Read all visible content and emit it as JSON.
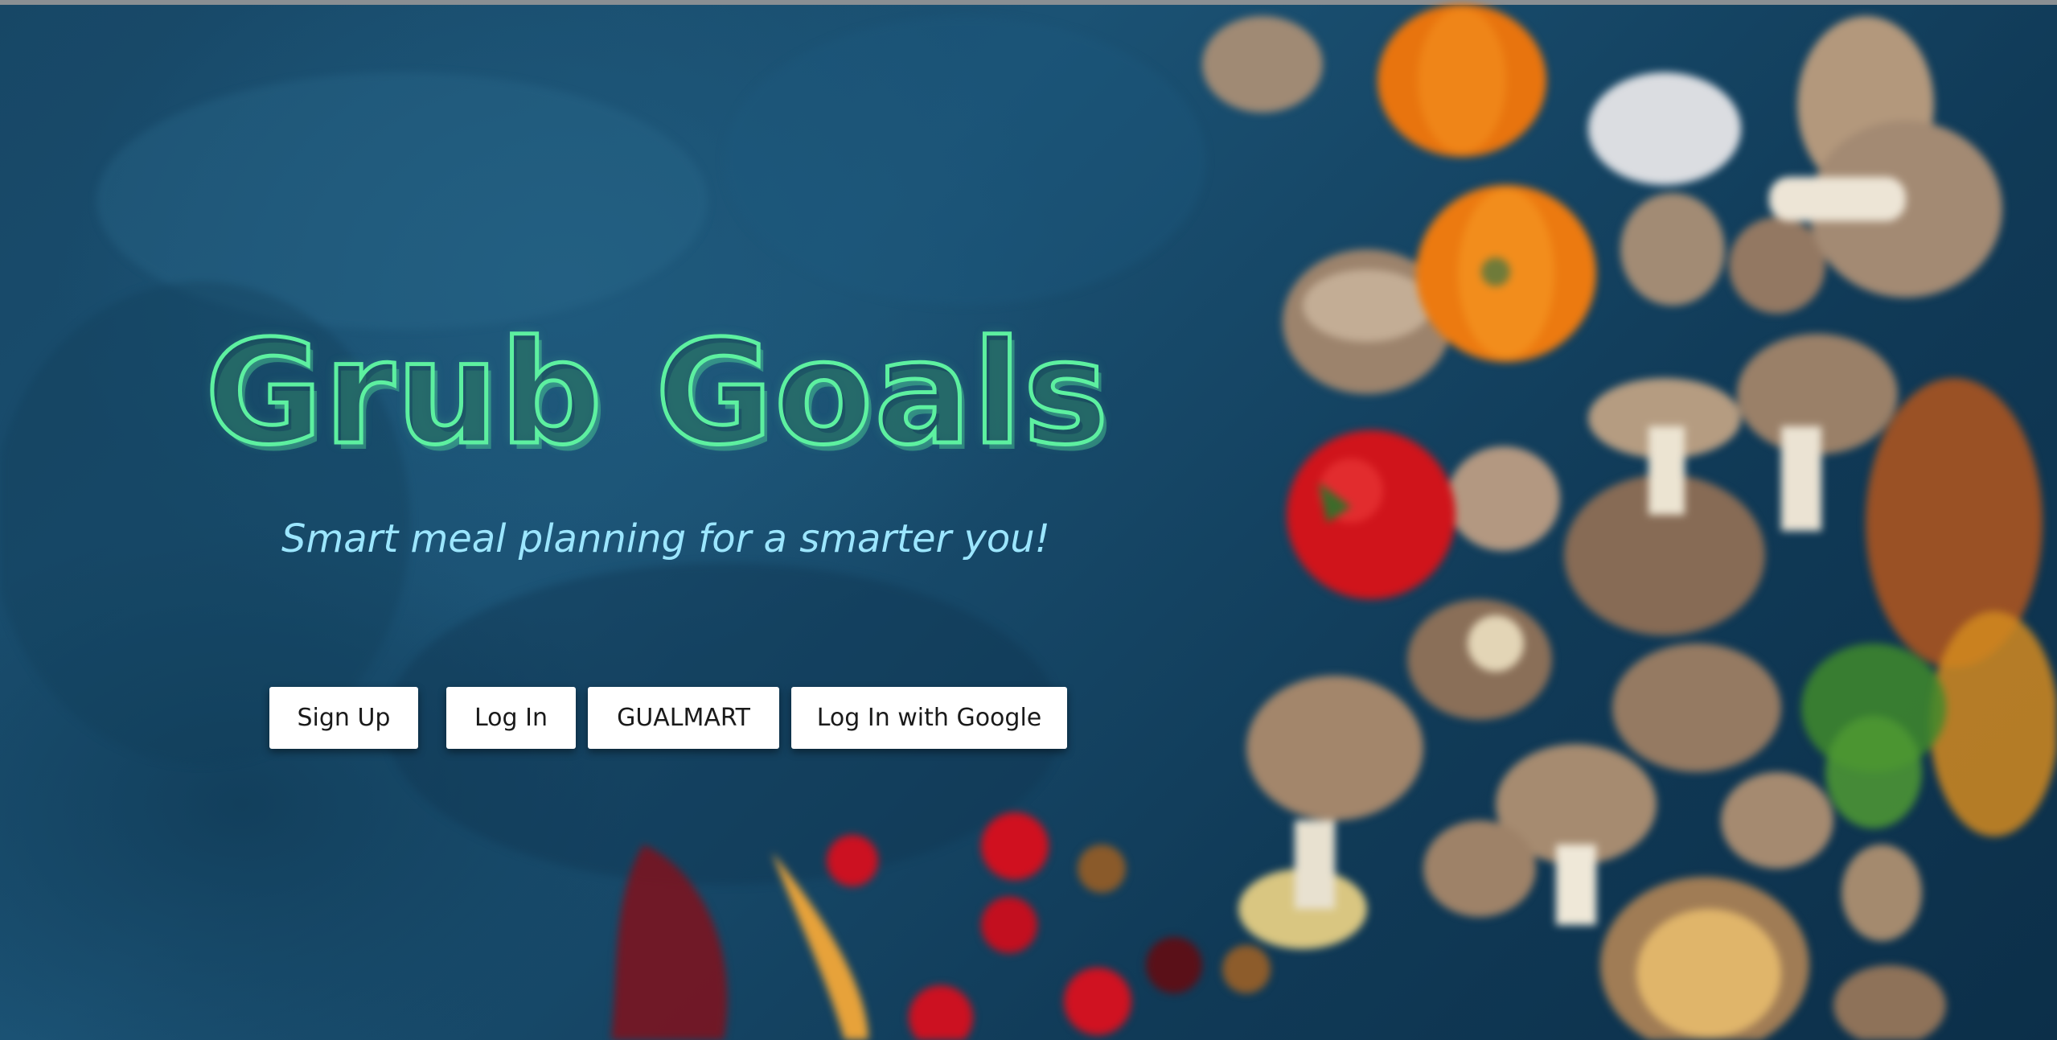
{
  "hero": {
    "title": "Grub Goals",
    "tagline": "Smart meal planning for a smarter you!"
  },
  "buttons": {
    "sign_up": "Sign Up",
    "log_in": "Log In",
    "gualmart": "GUALMART",
    "google": "Log In with Google"
  },
  "colors": {
    "title_outline": "#5df0a0",
    "tagline": "#9ce6ff",
    "background": "#174766",
    "button_bg": "#ffffff"
  },
  "background_image": "blurred-vegetables-mushrooms-pumpkins-on-blue-table"
}
